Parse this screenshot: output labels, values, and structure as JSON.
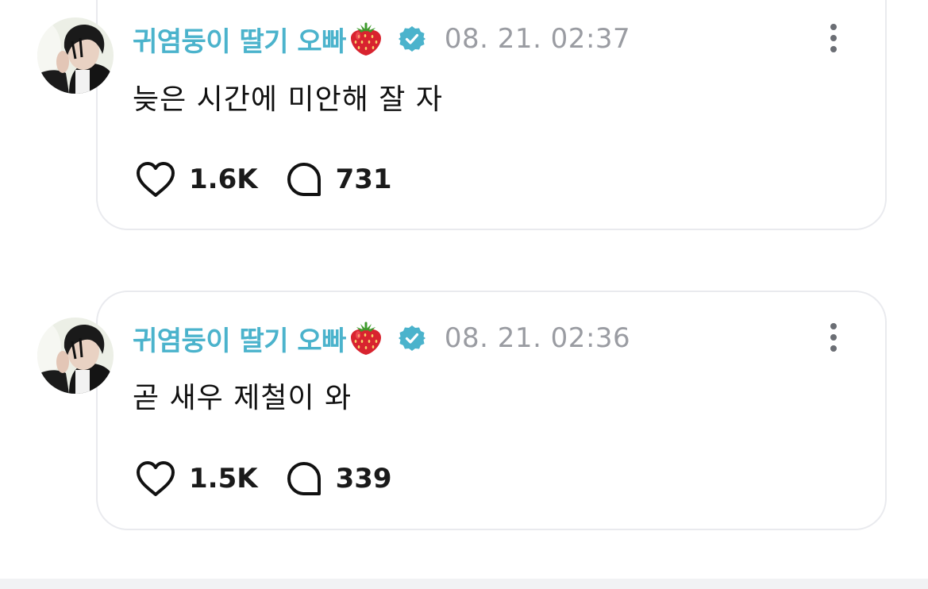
{
  "posts": [
    {
      "username": "귀염둥이 딸기 오빠",
      "timestamp": "08. 21. 02:37",
      "text": "늦은 시간에 미안해 잘 자",
      "likes": "1.6K",
      "comments": "731"
    },
    {
      "username": "귀염둥이 딸기 오빠",
      "timestamp": "08. 21. 02:36",
      "text": "곧 새우 제철이 와",
      "likes": "1.5K",
      "comments": "339"
    }
  ],
  "icons": {
    "emoji": "strawberry-icon",
    "verified": "verified-badge-icon",
    "more": "more-options-icon",
    "like": "heart-icon",
    "comment": "comment-bubble-icon"
  },
  "colors": {
    "username": "#4bb3cc",
    "verified": "#4bb3cc",
    "timestamp": "#9a9ca2",
    "text": "#111111",
    "card_border": "#e9eaee",
    "strawberry": "#d8232f"
  }
}
